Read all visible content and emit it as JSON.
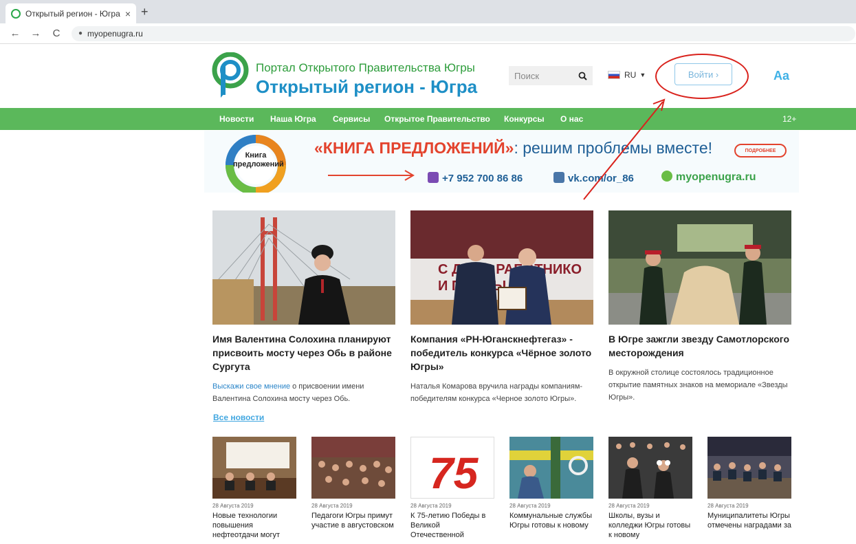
{
  "browser": {
    "tab_title": "Открытый регион - Югра",
    "close": "×",
    "new_tab": "+",
    "back": "←",
    "forward": "→",
    "reload": "C",
    "url": "myopenugra.ru"
  },
  "header": {
    "portal_title": "Портал Открытого Правительства Югры",
    "region_title": "Открытый регион - Югра",
    "search_placeholder": "Поиск",
    "language": "RU",
    "login_label": "Войти  ›",
    "font_toggle": "Aa"
  },
  "menu": {
    "items": [
      "Новости",
      "Наша Югра",
      "Сервисы",
      "Открытое Правительство",
      "Конкурсы",
      "О нас"
    ],
    "age_rating": "12+"
  },
  "banner": {
    "book_label": "Книга предложений",
    "headline_accent": "«КНИГА ПРЕДЛОЖЕНИЙ»",
    "headline_rest": ": решим проблемы вместе!",
    "more": "ПОДРОБНЕЕ",
    "phone": "+7 952 700 86 86",
    "vk": "vk.com/or_86",
    "site": "myopenugra.ru"
  },
  "colors": {
    "menu_green": "#5bb85b",
    "brand_blue": "#1e8fc6",
    "brand_green": "#2e9d3c",
    "annotation_red": "#d9221c"
  },
  "news": [
    {
      "title": "Имя Валентина Солохина планируют присвоить мосту через Обь в районе Сургута",
      "text_link": "Выскажи свое мнение",
      "text": " о присвоении имени Валентина Солохина мосту через Обь."
    },
    {
      "title": "Компания «РН-Юганскнефтегаз» - победитель конкурса «Чёрное золото Югры»",
      "text_link": "",
      "text": "Наталья Комарова вручила награды компаниям-победителям конкурса «Черное золото Югры»."
    },
    {
      "title": "В Югре зажгли звезду Самотлорского месторождения",
      "text_link": "",
      "text": "В окружной столице состоялось традиционное открытие памятных знаков на мемориале «Звезды Югры»."
    }
  ],
  "all_news": "Все новости",
  "photo_overlay": {
    "line1": "С ДНЕМ РАБОТНИКО",
    "line2": "И    ПРОМЫ"
  },
  "small_news": [
    {
      "date": "28 Августа 2019",
      "title": "Новые технологии повышения нефтеотдачи могут"
    },
    {
      "date": "28 Августа 2019",
      "title": "Педагоги Югры примут участие в августовском"
    },
    {
      "date": "28 Августа 2019",
      "title": "К 75-летию Победы в Великой Отечественной",
      "badge": "75"
    },
    {
      "date": "28 Августа 2019",
      "title": "Коммунальные службы Югры готовы к новому"
    },
    {
      "date": "28 Августа 2019",
      "title": "Школы, вузы и колледжи Югры готовы к новому"
    },
    {
      "date": "28 Августа 2019",
      "title": "Муниципалитеты Югры отмечены наградами за"
    }
  ]
}
